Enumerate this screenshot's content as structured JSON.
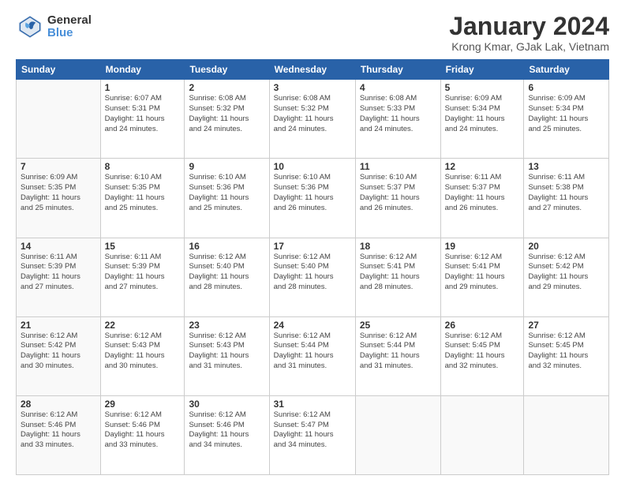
{
  "logo": {
    "general": "General",
    "blue": "Blue"
  },
  "title": "January 2024",
  "subtitle": "Krong Kmar, GJak Lak, Vietnam",
  "headers": [
    "Sunday",
    "Monday",
    "Tuesday",
    "Wednesday",
    "Thursday",
    "Friday",
    "Saturday"
  ],
  "weeks": [
    [
      {
        "num": "",
        "info": ""
      },
      {
        "num": "1",
        "info": "Sunrise: 6:07 AM\nSunset: 5:31 PM\nDaylight: 11 hours\nand 24 minutes."
      },
      {
        "num": "2",
        "info": "Sunrise: 6:08 AM\nSunset: 5:32 PM\nDaylight: 11 hours\nand 24 minutes."
      },
      {
        "num": "3",
        "info": "Sunrise: 6:08 AM\nSunset: 5:32 PM\nDaylight: 11 hours\nand 24 minutes."
      },
      {
        "num": "4",
        "info": "Sunrise: 6:08 AM\nSunset: 5:33 PM\nDaylight: 11 hours\nand 24 minutes."
      },
      {
        "num": "5",
        "info": "Sunrise: 6:09 AM\nSunset: 5:34 PM\nDaylight: 11 hours\nand 24 minutes."
      },
      {
        "num": "6",
        "info": "Sunrise: 6:09 AM\nSunset: 5:34 PM\nDaylight: 11 hours\nand 25 minutes."
      }
    ],
    [
      {
        "num": "7",
        "info": "Sunrise: 6:09 AM\nSunset: 5:35 PM\nDaylight: 11 hours\nand 25 minutes."
      },
      {
        "num": "8",
        "info": "Sunrise: 6:10 AM\nSunset: 5:35 PM\nDaylight: 11 hours\nand 25 minutes."
      },
      {
        "num": "9",
        "info": "Sunrise: 6:10 AM\nSunset: 5:36 PM\nDaylight: 11 hours\nand 25 minutes."
      },
      {
        "num": "10",
        "info": "Sunrise: 6:10 AM\nSunset: 5:36 PM\nDaylight: 11 hours\nand 26 minutes."
      },
      {
        "num": "11",
        "info": "Sunrise: 6:10 AM\nSunset: 5:37 PM\nDaylight: 11 hours\nand 26 minutes."
      },
      {
        "num": "12",
        "info": "Sunrise: 6:11 AM\nSunset: 5:37 PM\nDaylight: 11 hours\nand 26 minutes."
      },
      {
        "num": "13",
        "info": "Sunrise: 6:11 AM\nSunset: 5:38 PM\nDaylight: 11 hours\nand 27 minutes."
      }
    ],
    [
      {
        "num": "14",
        "info": "Sunrise: 6:11 AM\nSunset: 5:39 PM\nDaylight: 11 hours\nand 27 minutes."
      },
      {
        "num": "15",
        "info": "Sunrise: 6:11 AM\nSunset: 5:39 PM\nDaylight: 11 hours\nand 27 minutes."
      },
      {
        "num": "16",
        "info": "Sunrise: 6:12 AM\nSunset: 5:40 PM\nDaylight: 11 hours\nand 28 minutes."
      },
      {
        "num": "17",
        "info": "Sunrise: 6:12 AM\nSunset: 5:40 PM\nDaylight: 11 hours\nand 28 minutes."
      },
      {
        "num": "18",
        "info": "Sunrise: 6:12 AM\nSunset: 5:41 PM\nDaylight: 11 hours\nand 28 minutes."
      },
      {
        "num": "19",
        "info": "Sunrise: 6:12 AM\nSunset: 5:41 PM\nDaylight: 11 hours\nand 29 minutes."
      },
      {
        "num": "20",
        "info": "Sunrise: 6:12 AM\nSunset: 5:42 PM\nDaylight: 11 hours\nand 29 minutes."
      }
    ],
    [
      {
        "num": "21",
        "info": "Sunrise: 6:12 AM\nSunset: 5:42 PM\nDaylight: 11 hours\nand 30 minutes."
      },
      {
        "num": "22",
        "info": "Sunrise: 6:12 AM\nSunset: 5:43 PM\nDaylight: 11 hours\nand 30 minutes."
      },
      {
        "num": "23",
        "info": "Sunrise: 6:12 AM\nSunset: 5:43 PM\nDaylight: 11 hours\nand 31 minutes."
      },
      {
        "num": "24",
        "info": "Sunrise: 6:12 AM\nSunset: 5:44 PM\nDaylight: 11 hours\nand 31 minutes."
      },
      {
        "num": "25",
        "info": "Sunrise: 6:12 AM\nSunset: 5:44 PM\nDaylight: 11 hours\nand 31 minutes."
      },
      {
        "num": "26",
        "info": "Sunrise: 6:12 AM\nSunset: 5:45 PM\nDaylight: 11 hours\nand 32 minutes."
      },
      {
        "num": "27",
        "info": "Sunrise: 6:12 AM\nSunset: 5:45 PM\nDaylight: 11 hours\nand 32 minutes."
      }
    ],
    [
      {
        "num": "28",
        "info": "Sunrise: 6:12 AM\nSunset: 5:46 PM\nDaylight: 11 hours\nand 33 minutes."
      },
      {
        "num": "29",
        "info": "Sunrise: 6:12 AM\nSunset: 5:46 PM\nDaylight: 11 hours\nand 33 minutes."
      },
      {
        "num": "30",
        "info": "Sunrise: 6:12 AM\nSunset: 5:46 PM\nDaylight: 11 hours\nand 34 minutes."
      },
      {
        "num": "31",
        "info": "Sunrise: 6:12 AM\nSunset: 5:47 PM\nDaylight: 11 hours\nand 34 minutes."
      },
      {
        "num": "",
        "info": ""
      },
      {
        "num": "",
        "info": ""
      },
      {
        "num": "",
        "info": ""
      }
    ]
  ]
}
